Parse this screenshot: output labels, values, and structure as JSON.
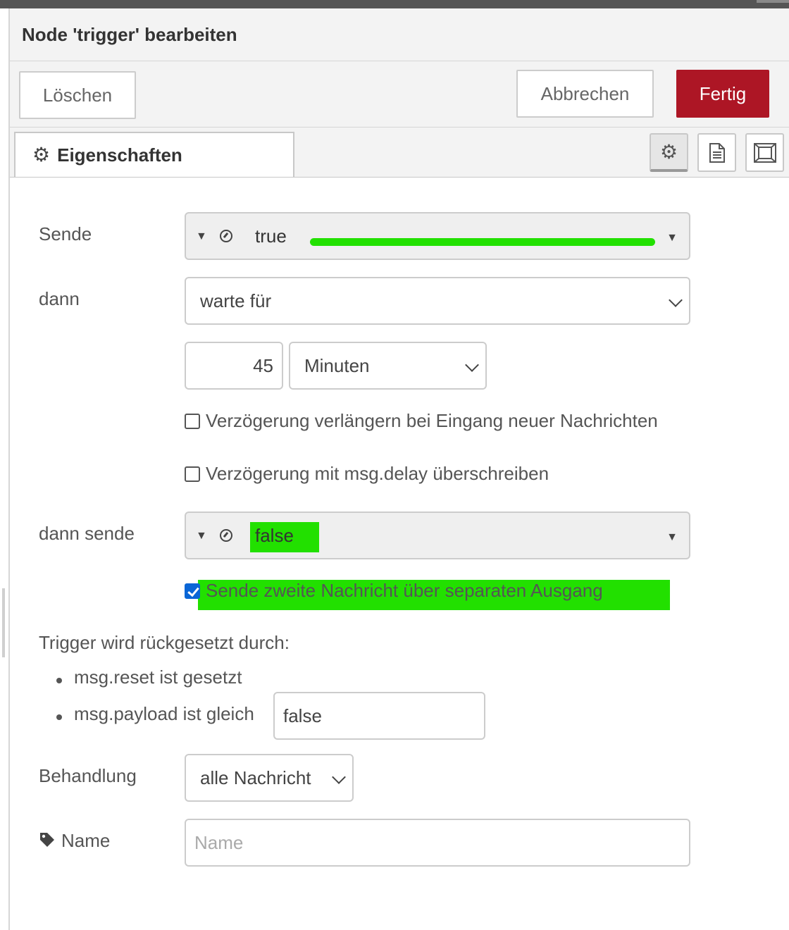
{
  "dialog": {
    "title": "Node 'trigger' bearbeiten"
  },
  "toolbar": {
    "delete_label": "Löschen",
    "cancel_label": "Abbrechen",
    "done_label": "Fertig"
  },
  "tabs": {
    "active_label": "Eigenschaften",
    "icons": [
      "gear-icon",
      "description-icon",
      "appearance-icon"
    ]
  },
  "form": {
    "send": {
      "label": "Sende",
      "type_icon": "constant-icon",
      "value": "true"
    },
    "then": {
      "label": "dann",
      "selected": "warte für"
    },
    "delay": {
      "value": "45",
      "unit": "Minuten"
    },
    "extend_checkbox": {
      "label": "Verzögerung verlängern bei Eingang neuer Nachrichten",
      "checked": false
    },
    "override_checkbox": {
      "label": "Verzögerung mit msg.delay überschreiben",
      "checked": false
    },
    "then_send": {
      "label": "dann sende",
      "type_icon": "constant-icon",
      "value": "false"
    },
    "second_output_checkbox": {
      "label": "Sende zweite Nachricht über separaten Ausgang",
      "checked": true
    },
    "reset": {
      "heading": "Trigger wird rückgesetzt durch:",
      "item1": "msg.reset ist gesetzt",
      "item2": "msg.payload ist gleich",
      "payload_value": "false"
    },
    "handling": {
      "label": "Behandlung",
      "selected": "alle Nachricht"
    },
    "name": {
      "label": "Name",
      "placeholder": "Name",
      "value": ""
    }
  },
  "colors": {
    "accent": "#ad1625",
    "highlight": "#22e000",
    "checkbox": "#0a66d6"
  }
}
